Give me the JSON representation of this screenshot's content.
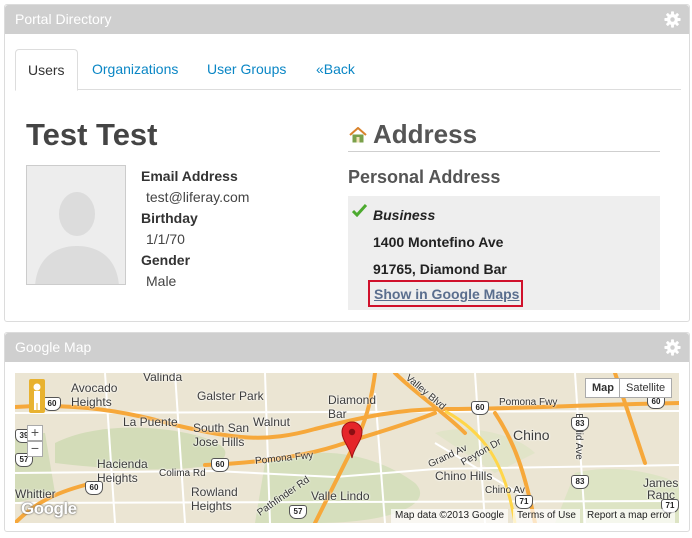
{
  "portlets": {
    "directory": {
      "title": "Portal Directory"
    },
    "map": {
      "title": "Google Map"
    }
  },
  "tabs": [
    {
      "label": "Users",
      "active": true
    },
    {
      "label": "Organizations",
      "active": false
    },
    {
      "label": "User Groups",
      "active": false
    },
    {
      "label": "«Back",
      "active": false
    }
  ],
  "user": {
    "name": "Test Test",
    "email_label": "Email Address",
    "email": "test@liferay.com",
    "birthday_label": "Birthday",
    "birthday": "1/1/70",
    "gender_label": "Gender",
    "gender": "Male"
  },
  "address": {
    "title": "Address",
    "section": "Personal Address",
    "type": "Business",
    "street": "1400 Montefino Ave",
    "city_line": "91765, Diamond Bar",
    "maps_link": "Show in Google Maps"
  },
  "map": {
    "type_map": "Map",
    "type_satellite": "Satellite",
    "zoom_in": "+",
    "zoom_out": "−",
    "logo": "Google",
    "attribution": "Map data ©2013 Google",
    "terms": "Terms of Use",
    "report": "Report a map error",
    "places": {
      "avocado_heights": "Avocado\nHeights",
      "valinda": "Valinda",
      "galster_park": "Galster Park",
      "la_puente": "La Puente",
      "south_san_jose_hills": "South San\nJose Hills",
      "walnut": "Walnut",
      "diamond_bar": "Diamond\nBar",
      "chino": "Chino",
      "hacienda_heights": "Hacienda\nHeights",
      "rowland_heights": "Rowland\nHeights",
      "valle_lindo": "Valle Lindo",
      "chino_hills": "Chino Hills",
      "whittier": "Whittier",
      "james": "James",
      "ranch": "Ranc",
      "pomona_fwy_1": "Pomona Fwy",
      "pomona_fwy_2": "Pomona Fwy",
      "colima_rd": "Colima Rd",
      "grand_av": "Grand Av",
      "euclid_av": "Euclid Ave",
      "valley_blvd": "Valley Blvd",
      "pathfinder_rd": "Pathfinder Rd",
      "peyton_dr": "Peyton Dr",
      "chino_av": "Chino Av"
    },
    "shields": [
      "60",
      "60",
      "60",
      "60",
      "57",
      "71",
      "83",
      "83",
      "39",
      "57",
      "60",
      "71"
    ]
  },
  "colors": {
    "header_bg": "#cfcfcf",
    "link": "#0a86c5",
    "highlight": "#d0112b",
    "check": "#4caa2f",
    "map_road": "#f6a83b"
  }
}
